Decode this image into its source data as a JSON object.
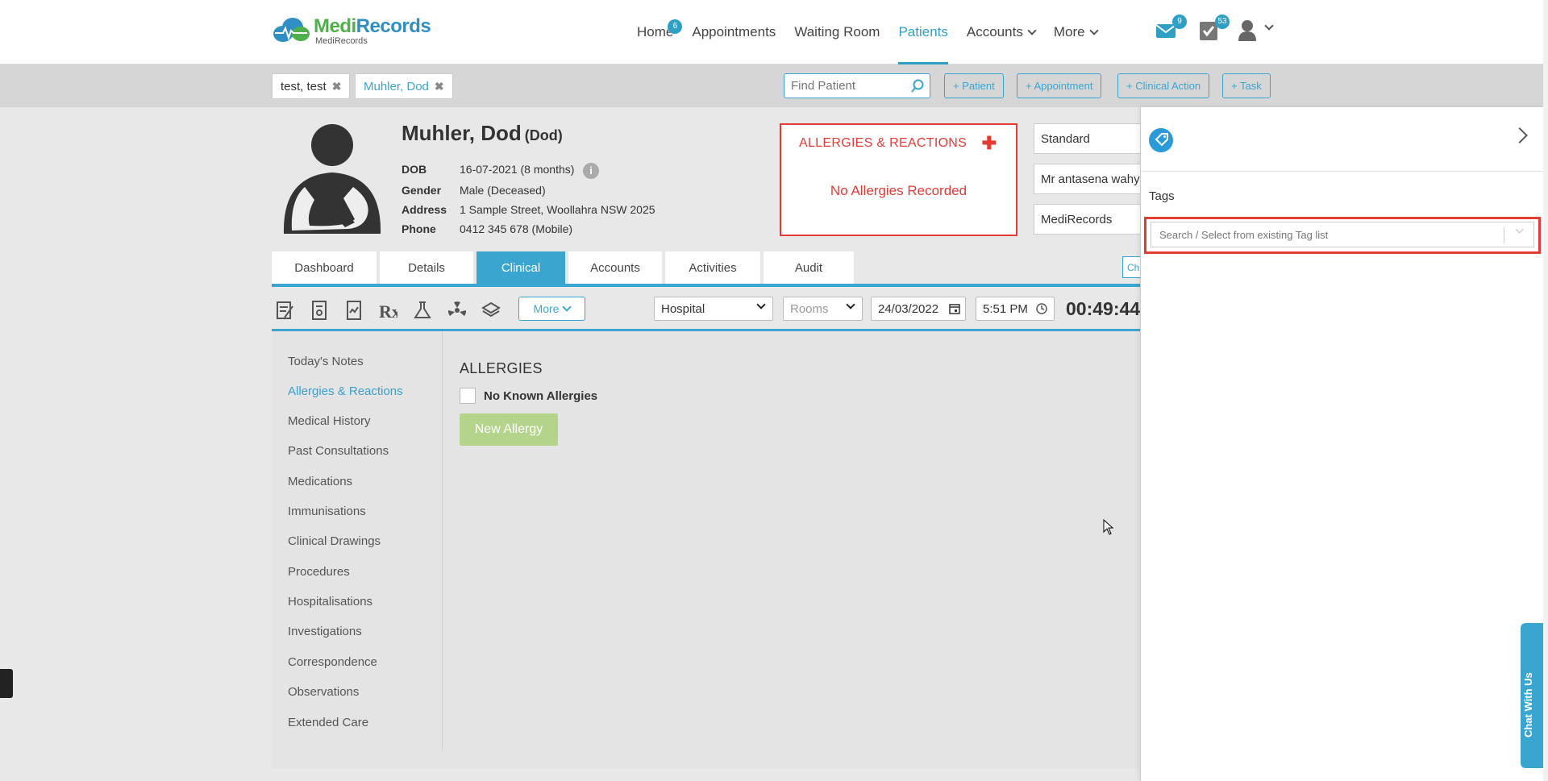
{
  "brand": {
    "name_part1": "Medi",
    "name_part2": "Records",
    "sub": "MediRecords"
  },
  "nav": {
    "home": "Home",
    "home_badge": "6",
    "appointments": "Appointments",
    "waiting_room": "Waiting Room",
    "patients": "Patients",
    "accounts": "Accounts",
    "more": "More",
    "mail_badge": "9",
    "tasks_badge": "53"
  },
  "patient_tabs": [
    {
      "label": "test, test"
    },
    {
      "label": "Muhler, Dod"
    }
  ],
  "search": {
    "placeholder": "Find Patient"
  },
  "quick_actions": [
    "+ Patient",
    "+ Appointment",
    "+ Clinical Action",
    "+ Task"
  ],
  "patient": {
    "name": "Muhler, Dod",
    "preferred": "(Dod)",
    "fields": [
      {
        "key": "DOB",
        "value": "16-07-2021 (8 months)"
      },
      {
        "key": "Gender",
        "value": "Male (Deceased)"
      },
      {
        "key": "Address",
        "value": "1 Sample Street, Woollahra NSW 2025"
      },
      {
        "key": "Phone",
        "value": "0412 345 678 (Mobile)"
      }
    ]
  },
  "allergies_box": {
    "title": "ALLERGIES & REACTIONS",
    "empty": "No Allergies Recorded"
  },
  "right_selects": {
    "billing": "Standard",
    "practitioner": "Mr antasena wahy",
    "practice": "MediRecords",
    "button_fragment": "Ch"
  },
  "tabs": [
    "Dashboard",
    "Details",
    "Clinical",
    "Accounts",
    "Activities",
    "Audit"
  ],
  "active_tab": "Clinical",
  "toolbar": {
    "more": "More",
    "location": "Hospital",
    "rooms_placeholder": "Rooms",
    "date": "24/03/2022",
    "time": "5:51 PM",
    "timer": "00:49:44"
  },
  "left_nav": [
    "Today's Notes",
    "Allergies & Reactions",
    "Medical History",
    "Past Consultations",
    "Medications",
    "Immunisations",
    "Clinical Drawings",
    "Procedures",
    "Hospitalisations",
    "Investigations",
    "Correspondence",
    "Observations",
    "Extended Care"
  ],
  "left_nav_active": "Allergies & Reactions",
  "allergies_section": {
    "title": "ALLERGIES",
    "no_known": "No Known Allergies",
    "new_button": "New Allergy"
  },
  "tags_panel": {
    "label": "Tags",
    "placeholder": "Search / Select from existing Tag list"
  },
  "chat": {
    "label": "Chat With Us"
  },
  "colors": {
    "accent": "#3aa6d0",
    "alert": "#e23b34",
    "brand_green": "#4db04a",
    "brand_blue": "#2f8fc2"
  }
}
